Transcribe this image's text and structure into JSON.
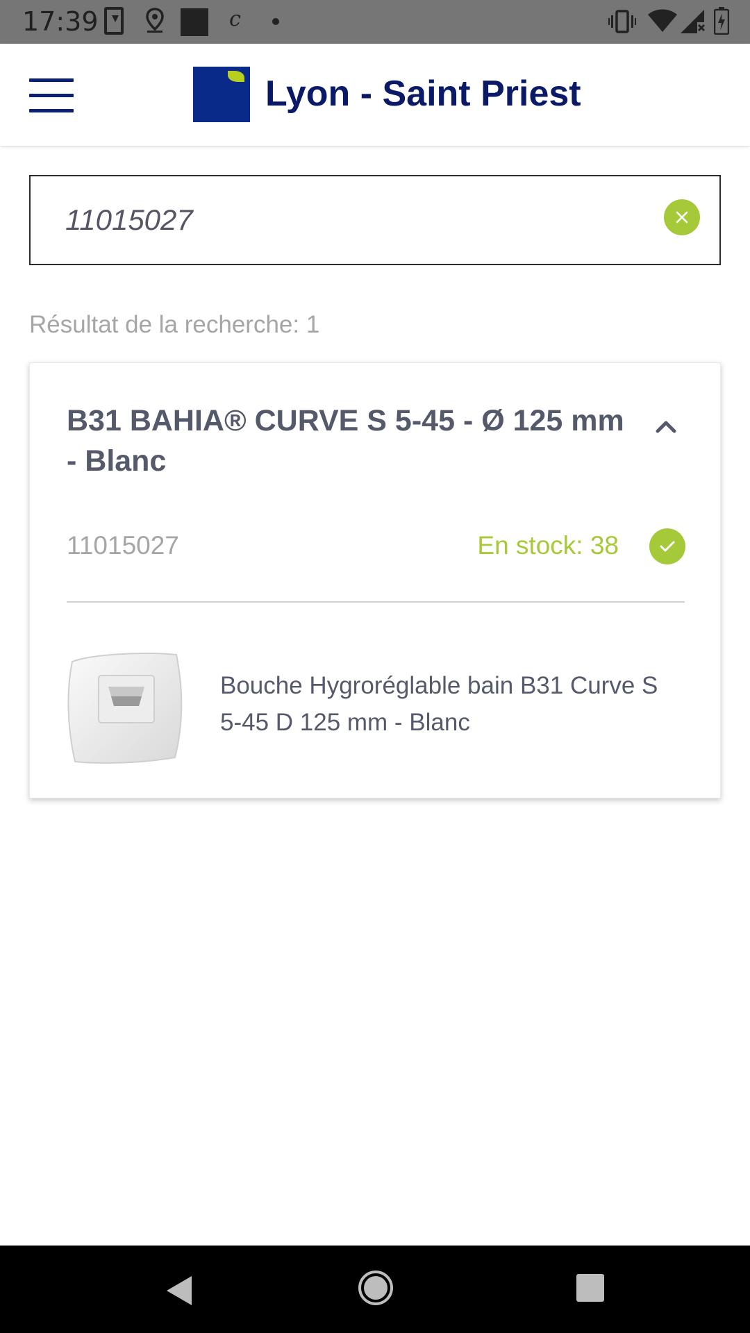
{
  "status_bar": {
    "time": "17:39",
    "notification_icons": [
      "download-icon",
      "location-icon",
      "image-icon",
      "c-icon",
      "dot-icon"
    ],
    "system_icons": [
      "vibrate-icon",
      "wifi-icon",
      "signal-icon",
      "battery-icon"
    ]
  },
  "header": {
    "title": "Lyon - Saint Priest",
    "menu_icon": "hamburger-menu-icon",
    "logo_colors": {
      "blue": "#0a2a8a",
      "green": "#b7cf1e"
    }
  },
  "search": {
    "value": "11015027",
    "clear_icon": "close-icon"
  },
  "results": {
    "count_label": "Résultat de la recherche: 1",
    "items": [
      {
        "title": "B31 BAHIA® CURVE S 5-45 - Ø 125 mm - Blanc",
        "reference": "11015027",
        "stock_label": "En stock: 38",
        "description": "Bouche Hygroréglable bain B31 Curve S 5-45 D 125 mm - Blanc",
        "expanded": true
      }
    ]
  },
  "colors": {
    "accent_green": "#a6c93a",
    "title_navy": "#0b1a66",
    "text_gray": "#555a6b",
    "muted_gray": "#a5a5a8"
  },
  "nav_bar": {
    "buttons": [
      "back-icon",
      "home-icon",
      "recent-apps-icon"
    ]
  }
}
